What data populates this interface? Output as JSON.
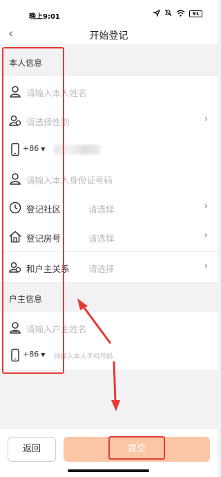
{
  "status_bar": {
    "time": "晚上9:01",
    "battery": "91"
  },
  "nav": {
    "back_glyph": "‹",
    "title": "开始登记"
  },
  "self_section": {
    "header": "本人信息",
    "name_placeholder": "请输入本人姓名",
    "gender_placeholder": "请选择性别",
    "phone_country_code": "+86",
    "id_placeholder": "请输入本人身份证号码",
    "community_label": "登记社区",
    "community_value": "请选择",
    "room_label": "登记房号",
    "room_value": "请选择",
    "relation_label": "和户主关系",
    "relation_value": "请选择"
  },
  "owner_section": {
    "header": "户主信息",
    "name_placeholder": "请输入户主姓名",
    "phone_country_code": "+86",
    "phone_placeholder": "请输入本人手机号码"
  },
  "footer": {
    "back_label": "返回",
    "submit_label": "提交"
  },
  "colors": {
    "submit_bg": "#fbc6a6",
    "annotation": "#e53935"
  }
}
